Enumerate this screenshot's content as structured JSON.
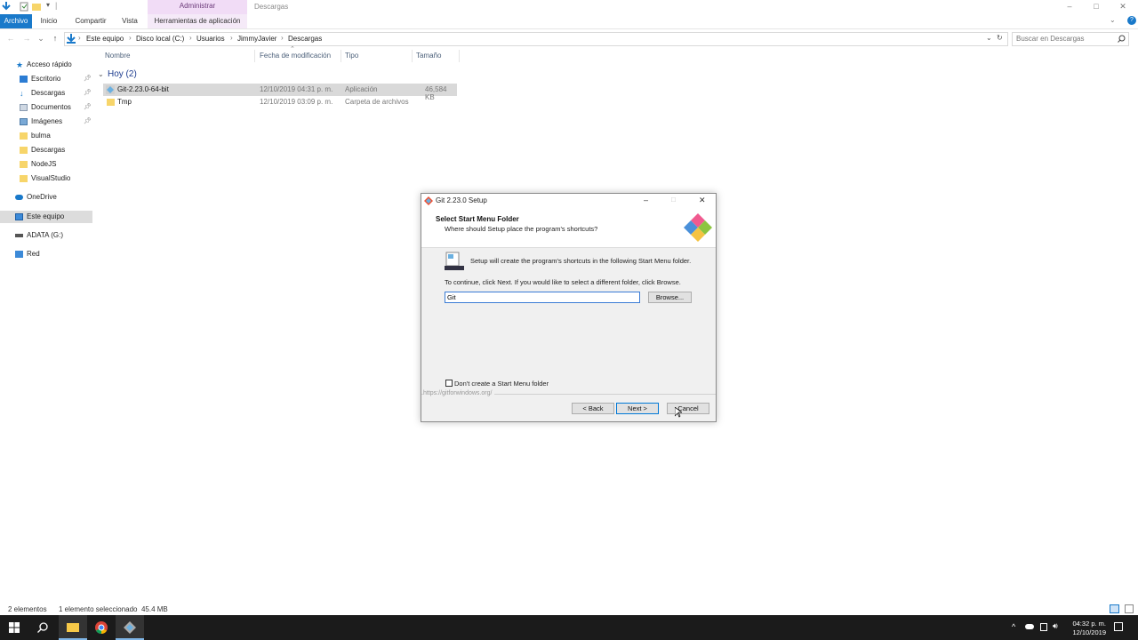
{
  "window": {
    "title": "Descargas",
    "context_tab": "Administrar",
    "controls": {
      "minimize": "–",
      "maximize": "□",
      "close": "✕"
    }
  },
  "ribbon": {
    "tabs": [
      "Archivo",
      "Inicio",
      "Compartir",
      "Vista",
      "Herramientas de aplicación"
    ],
    "help": "?"
  },
  "address": {
    "breadcrumbs": [
      "Este equipo",
      "Disco local (C:)",
      "Usuarios",
      "JimmyJavier",
      "Descargas"
    ],
    "search_placeholder": "Buscar en Descargas"
  },
  "nav": {
    "items": [
      {
        "label": "Acceso rápido",
        "icon": "star-icon",
        "pinned": false
      },
      {
        "label": "Escritorio",
        "icon": "desktop-icon",
        "pinned": true
      },
      {
        "label": "Descargas",
        "icon": "download-icon",
        "pinned": true
      },
      {
        "label": "Documentos",
        "icon": "document-icon",
        "pinned": true
      },
      {
        "label": "Imágenes",
        "icon": "image-icon",
        "pinned": true
      },
      {
        "label": "bulma",
        "icon": "folder-icon",
        "pinned": false
      },
      {
        "label": "Descargas",
        "icon": "folder-icon",
        "pinned": false
      },
      {
        "label": "NodeJS",
        "icon": "folder-icon",
        "pinned": false
      },
      {
        "label": "VisualStudio",
        "icon": "folder-icon",
        "pinned": false
      },
      {
        "label": "OneDrive",
        "icon": "cloud-icon",
        "pinned": false
      },
      {
        "label": "Este equipo",
        "icon": "computer-icon",
        "pinned": false
      },
      {
        "label": "ADATA (G:)",
        "icon": "drive-icon",
        "pinned": false
      },
      {
        "label": "Red",
        "icon": "network-icon",
        "pinned": false
      }
    ]
  },
  "files": {
    "columns": [
      "Nombre",
      "Fecha de modificación",
      "Tipo",
      "Tamaño"
    ],
    "group": "Hoy (2)",
    "rows": [
      {
        "name": "Git-2.23.0-64-bit",
        "date": "12/10/2019 04:31 p. m.",
        "type": "Aplicación",
        "size": "46,584 KB"
      },
      {
        "name": "Tmp",
        "date": "12/10/2019 03:09 p. m.",
        "type": "Carpeta de archivos",
        "size": ""
      }
    ]
  },
  "status": {
    "count": "2 elementos",
    "selection": "1 elemento seleccionado  45.4 MB"
  },
  "dialog": {
    "title": "Git 2.23.0 Setup",
    "heading": "Select Start Menu Folder",
    "subheading": "Where should Setup place the program's shortcuts?",
    "info": "Setup will create the program's shortcuts in the following Start Menu folder.",
    "instruction": "To continue, click Next. If you would like to select a different folder, click Browse.",
    "folder_value": "Git",
    "browse_label": "Browse...",
    "checkbox_label": "Don't create a Start Menu folder",
    "checkbox_checked": false,
    "footer_url": "https://gitforwindows.org/",
    "back_label": "< Back",
    "next_label": "Next >",
    "cancel_label": "Cancel"
  },
  "taskbar": {
    "time": "04:32 p. m.",
    "date": "12/10/2019"
  }
}
